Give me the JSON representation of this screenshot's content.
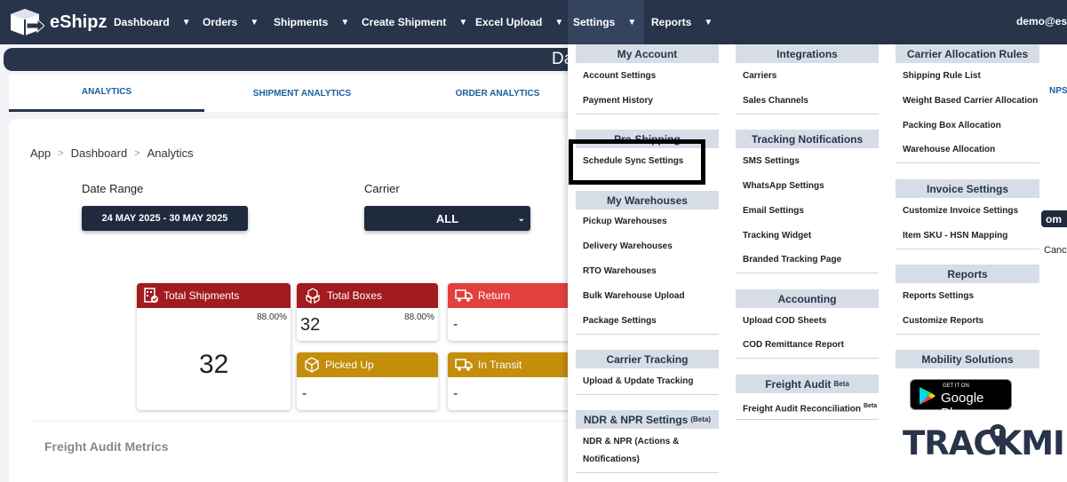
{
  "app": {
    "name": "eShipz",
    "user": "demo@es"
  },
  "nav": [
    {
      "label": "Dashboard"
    },
    {
      "label": "Orders"
    },
    {
      "label": "Shipments"
    },
    {
      "label": "Create Shipment"
    },
    {
      "label": "Excel Upload"
    },
    {
      "label": "Settings"
    },
    {
      "label": "Reports"
    }
  ],
  "banner": {
    "title": "Da"
  },
  "tabs": [
    "ANALYTICS",
    "SHIPMENT ANALYTICS",
    "ORDER ANALYTICS",
    "NPS"
  ],
  "breadcrumb": [
    "App",
    "Dashboard",
    "Analytics"
  ],
  "filters": {
    "date_label": "Date Range",
    "date_value": "24 MAY 2025 - 30 MAY 2025",
    "carrier_label": "Carrier",
    "carrier_value": "ALL"
  },
  "cards": {
    "total_shipments": {
      "title": "Total Shipments",
      "pct": "88.00%",
      "value": "32"
    },
    "total_boxes": {
      "title": "Total Boxes",
      "pct": "88.00%",
      "value": "32"
    },
    "return": {
      "title": "Return",
      "value": "-"
    },
    "picked_up": {
      "title": "Picked Up",
      "value": "-"
    },
    "in_transit": {
      "title": "In Transit",
      "value": "-"
    }
  },
  "freight_title": "Freight Audit Metrics",
  "menu": {
    "col1": {
      "my_account": {
        "title": "My Account",
        "items": [
          "Account Settings",
          "Payment History"
        ]
      },
      "pre_shipping": {
        "title": "Pre-Shipping",
        "items": [
          "Schedule Sync Settings"
        ]
      },
      "my_warehouses": {
        "title": "My Warehouses",
        "items": [
          "Pickup Warehouses",
          "Delivery Warehouses",
          "RTO Warehouses",
          "Bulk Warehouse Upload",
          "Package Settings"
        ]
      },
      "carrier_tracking": {
        "title": "Carrier Tracking",
        "items": [
          "Upload & Update Tracking"
        ]
      },
      "ndr": {
        "title": "NDR & NPR Settings",
        "badge": "(Beta)",
        "items": [
          "NDR & NPR (Actions &",
          "Notifications)"
        ]
      }
    },
    "col2": {
      "integrations": {
        "title": "Integrations",
        "items": [
          "Carriers",
          "Sales Channels"
        ]
      },
      "tracking_notifications": {
        "title": "Tracking Notifications",
        "items": [
          "SMS Settings",
          "WhatsApp Settings",
          "Email Settings",
          "Tracking Widget",
          "Branded Tracking Page"
        ]
      },
      "accounting": {
        "title": "Accounting",
        "items": [
          "Upload COD Sheets",
          "COD Remittance Report"
        ]
      },
      "freight_audit": {
        "title": "Freight Audit",
        "badge": "Beta",
        "items": [
          "Freight Audit Reconciliation"
        ],
        "item_badge": "Beta"
      }
    },
    "col3": {
      "carrier_allocation": {
        "title": "Carrier Allocation Rules",
        "items": [
          "Shipping Rule List",
          "Weight Based Carrier Allocation",
          "Packing Box Allocation",
          "Warehouse Allocation"
        ]
      },
      "invoice": {
        "title": "Invoice Settings",
        "items": [
          "Customize Invoice Settings",
          "Item SKU - HSN Mapping"
        ]
      },
      "reports": {
        "title": "Reports",
        "items": [
          "Reports Settings",
          "Customize Reports"
        ]
      },
      "mobility": {
        "title": "Mobility Solutions"
      },
      "gplay": {
        "small": "GET IT ON",
        "big": "Google Play"
      },
      "trackmile": "TRACKMILE"
    }
  },
  "edge": {
    "pill": "om",
    "text": "Canc"
  }
}
